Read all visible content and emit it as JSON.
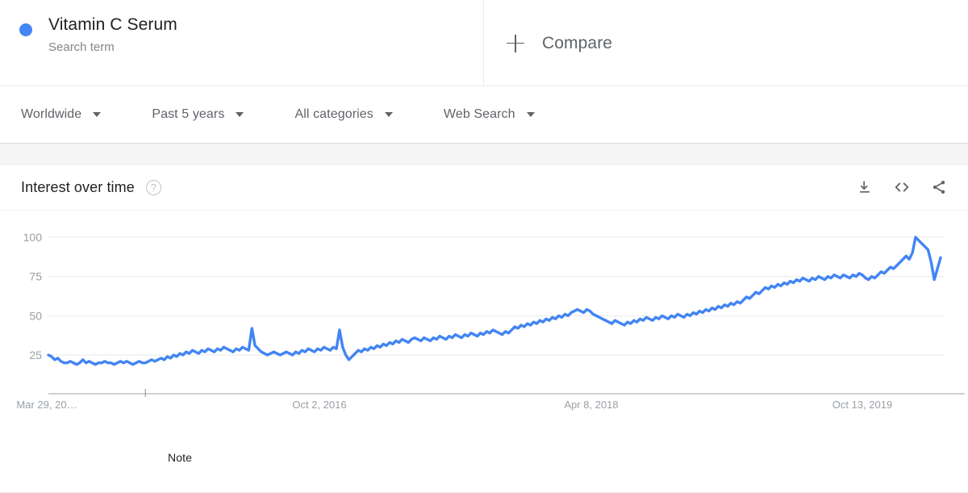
{
  "term": {
    "title": "Vitamin C Serum",
    "subtitle": "Search term",
    "dot_color": "#4285f4"
  },
  "compare": {
    "label": "Compare",
    "icon": "plus-icon"
  },
  "filters": [
    {
      "label": "Worldwide",
      "icon": "chevron-down-icon"
    },
    {
      "label": "Past 5 years",
      "icon": "chevron-down-icon"
    },
    {
      "label": "All categories",
      "icon": "chevron-down-icon"
    },
    {
      "label": "Web Search",
      "icon": "chevron-down-icon"
    }
  ],
  "card": {
    "title": "Interest over time",
    "help_icon": "?",
    "actions": [
      {
        "name": "download-icon"
      },
      {
        "name": "embed-icon"
      },
      {
        "name": "share-icon"
      }
    ]
  },
  "chart_data": {
    "type": "line",
    "title": "Interest over time",
    "xlabel": "",
    "ylabel": "",
    "ylim": [
      0,
      108
    ],
    "yticks": [
      25,
      50,
      75,
      100
    ],
    "grid": true,
    "legend": "none",
    "line_color": "#4285f4",
    "series_name": "Vitamin C Serum",
    "xticks": [
      "Mar 29, 20…",
      "Oct 2, 2016",
      "Apr 8, 2018",
      "Oct 13, 2019"
    ],
    "annotations": [
      {
        "text": "Note",
        "x_index": 31
      }
    ],
    "values": [
      25,
      24,
      22,
      23,
      21,
      20,
      20,
      21,
      20,
      19,
      20,
      22,
      20,
      21,
      20,
      19,
      20,
      20,
      21,
      20,
      20,
      19,
      20,
      21,
      20,
      21,
      20,
      19,
      20,
      21,
      20,
      20,
      21,
      22,
      21,
      22,
      23,
      22,
      24,
      23,
      25,
      24,
      26,
      25,
      27,
      26,
      28,
      27,
      26,
      28,
      27,
      29,
      28,
      27,
      29,
      28,
      30,
      29,
      28,
      27,
      29,
      28,
      30,
      29,
      28,
      42,
      31,
      29,
      27,
      26,
      25,
      26,
      27,
      26,
      25,
      26,
      27,
      26,
      25,
      27,
      26,
      28,
      27,
      29,
      28,
      27,
      29,
      28,
      30,
      29,
      28,
      30,
      29,
      41,
      30,
      25,
      22,
      24,
      26,
      28,
      27,
      29,
      28,
      30,
      29,
      31,
      30,
      32,
      31,
      33,
      32,
      34,
      33,
      35,
      34,
      33,
      35,
      36,
      35,
      34,
      36,
      35,
      34,
      36,
      35,
      37,
      36,
      35,
      37,
      36,
      38,
      37,
      36,
      38,
      37,
      39,
      38,
      37,
      39,
      38,
      40,
      39,
      41,
      40,
      39,
      38,
      40,
      39,
      41,
      43,
      42,
      44,
      43,
      45,
      44,
      46,
      45,
      47,
      46,
      48,
      47,
      49,
      48,
      50,
      49,
      51,
      50,
      52,
      53,
      54,
      53,
      52,
      54,
      53,
      51,
      50,
      49,
      48,
      47,
      46,
      45,
      47,
      46,
      45,
      44,
      46,
      45,
      47,
      46,
      48,
      47,
      49,
      48,
      47,
      49,
      48,
      50,
      49,
      48,
      50,
      49,
      51,
      50,
      49,
      51,
      50,
      52,
      51,
      53,
      52,
      54,
      53,
      55,
      54,
      56,
      55,
      57,
      56,
      58,
      57,
      59,
      58,
      60,
      62,
      61,
      63,
      65,
      64,
      66,
      68,
      67,
      69,
      68,
      70,
      69,
      71,
      70,
      72,
      71,
      73,
      72,
      74,
      73,
      72,
      74,
      73,
      75,
      74,
      73,
      75,
      74,
      76,
      75,
      74,
      76,
      75,
      74,
      76,
      75,
      77,
      76,
      74,
      73,
      75,
      74,
      76,
      78,
      77,
      79,
      81,
      80,
      82,
      84,
      86,
      88,
      86,
      90,
      100,
      98,
      96,
      94,
      92,
      84,
      73,
      80,
      87
    ]
  }
}
